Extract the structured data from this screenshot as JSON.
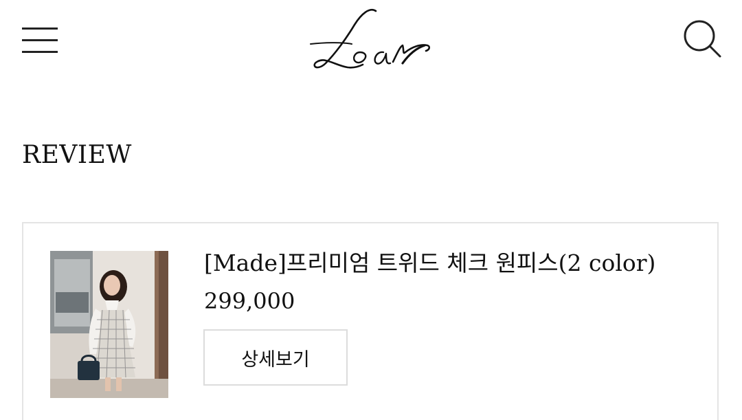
{
  "header": {
    "menu_icon": "hamburger-menu-icon",
    "logo_text": "Loar",
    "search_icon": "search-icon"
  },
  "section": {
    "title": "REVIEW"
  },
  "review": {
    "product_name": "[Made]프리미엄 트위드 체크 원피스(2 color)",
    "price": "299,000",
    "detail_button_label": "상세보기",
    "thumbnail_alt": "product photo: woman in tweed check dress holding a black handbag"
  },
  "colors": {
    "background": "#ffffff",
    "text": "#111111",
    "border": "#e4e4e4"
  }
}
